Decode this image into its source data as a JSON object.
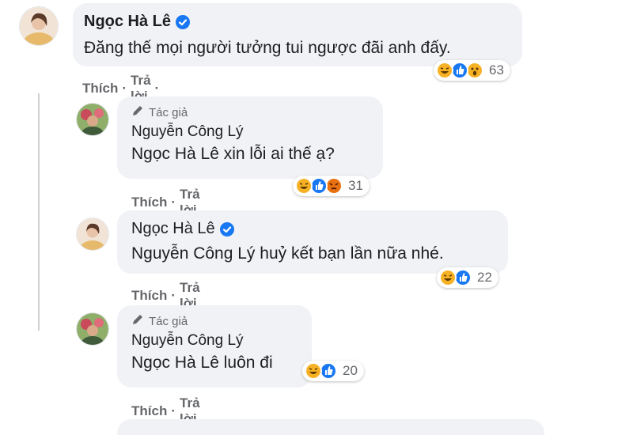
{
  "comments": [
    {
      "name": "Ngọc Hà Lê",
      "verified": true,
      "author_badge": "",
      "mention": "",
      "text": "Đăng thế mọi người tưởng tui ngược đãi anh đấy.",
      "actions": {
        "like": "Thích",
        "reply": "Trả lời",
        "dot": "·"
      },
      "reactions": {
        "icons": [
          "haha-icon",
          "like-icon",
          "wow-icon"
        ],
        "count": "63"
      }
    },
    {
      "name": "Nguyễn Công Lý",
      "verified": false,
      "author_badge": "Tác giả",
      "mention": "Ngọc Hà Lê",
      "text": "xin lỗi ai thế ạ?",
      "actions": {
        "like": "Thích",
        "reply": "Trả lời",
        "dot": "·"
      },
      "reactions": {
        "icons": [
          "haha-icon",
          "like-icon",
          "angry-icon"
        ],
        "count": "31"
      }
    },
    {
      "name": "Ngọc Hà Lê",
      "verified": true,
      "author_badge": "",
      "mention": "Nguyễn Công Lý",
      "text": "huỷ kết bạn lần nữa nhé.",
      "actions": {
        "like": "Thích",
        "reply": "Trả lời",
        "dot": "·"
      },
      "reactions": {
        "icons": [
          "haha-icon",
          "like-icon"
        ],
        "count": "22"
      }
    },
    {
      "name": "Nguyễn Công Lý",
      "verified": false,
      "author_badge": "Tác giả",
      "mention": "Ngọc Hà Lê",
      "text": "luôn đi",
      "actions": {
        "like": "Thích",
        "reply": "Trả lời",
        "dot": "·"
      },
      "reactions": {
        "icons": [
          "haha-icon",
          "like-icon"
        ],
        "count": "20"
      }
    }
  ],
  "colors": {
    "bubble": "#f0f2f5",
    "secondary_text": "#65676b",
    "verified": "#1877f2",
    "haha": "#f7b125",
    "like": "#1877f2",
    "angry": "#e9710f"
  }
}
